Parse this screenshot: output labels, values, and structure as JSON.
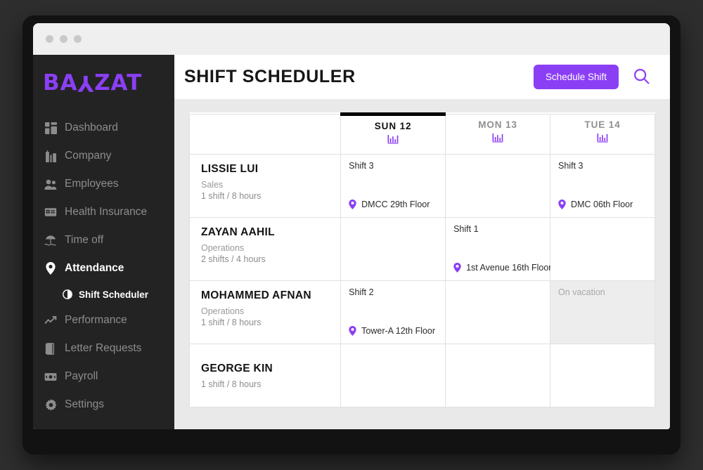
{
  "window": {
    "dots": [
      "close-dot",
      "minimize-dot",
      "maximize-dot"
    ]
  },
  "brand": {
    "logo_full": "BAYZAT",
    "logo_part1": "BA",
    "logo_flip": "Y",
    "logo_part2": "ZAT",
    "color": "#8b3ff5"
  },
  "sidebar": {
    "items": [
      {
        "label": "Dashboard",
        "icon": "dashboard-icon",
        "active": false
      },
      {
        "label": "Company",
        "icon": "company-icon",
        "active": false
      },
      {
        "label": "Employees",
        "icon": "employees-icon",
        "active": false
      },
      {
        "label": "Health Insurance",
        "icon": "health-insurance-icon",
        "active": false
      },
      {
        "label": "Time off",
        "icon": "time-off-icon",
        "active": false
      },
      {
        "label": "Attendance",
        "icon": "location-pin-icon",
        "active": true
      },
      {
        "label": "Performance",
        "icon": "performance-icon",
        "active": false
      },
      {
        "label": "Letter Requests",
        "icon": "letter-requests-icon",
        "active": false
      },
      {
        "label": "Payroll",
        "icon": "payroll-icon",
        "active": false
      },
      {
        "label": "Settings",
        "icon": "settings-gear-icon",
        "active": false
      }
    ],
    "subitem": {
      "label": "Shift Scheduler",
      "icon": "half-circle-icon",
      "active": true
    }
  },
  "header": {
    "title": "SHIFT SCHEDULER",
    "schedule_button": "Schedule Shift",
    "search_icon": "search-icon"
  },
  "table": {
    "columns": [
      {
        "label": "",
        "today": false
      },
      {
        "label": "SUN 12",
        "today": true,
        "icon": "bar-chart-icon"
      },
      {
        "label": "MON 13",
        "today": false,
        "icon": "bar-chart-icon"
      },
      {
        "label": "TUE 14",
        "today": false,
        "icon": "bar-chart-icon"
      }
    ],
    "rows": [
      {
        "name": "LISSIE LUI",
        "dept": "Sales",
        "hours": "1 shift / 8 hours",
        "cells": [
          {
            "shift": "Shift 3",
            "location": "DMCC 29th Floor",
            "state": "shift"
          },
          {
            "shift": "",
            "location": "",
            "state": "empty"
          },
          {
            "shift": "Shift 3",
            "location": "DMC 06th Floor",
            "state": "shift"
          }
        ]
      },
      {
        "name": "ZAYAN AAHIL",
        "dept": "Operations",
        "hours": "2 shifts / 4 hours",
        "cells": [
          {
            "shift": "",
            "location": "",
            "state": "empty"
          },
          {
            "shift": "Shift 1",
            "location": "1st Avenue 16th Floor",
            "state": "shift"
          },
          {
            "shift": "",
            "location": "",
            "state": "empty"
          }
        ]
      },
      {
        "name": "MOHAMMED AFNAN",
        "dept": "Operations",
        "hours": "1 shift / 8 hours",
        "cells": [
          {
            "shift": "Shift 2",
            "location": "Tower-A 12th Floor",
            "state": "shift"
          },
          {
            "shift": "",
            "location": "",
            "state": "empty"
          },
          {
            "shift": "",
            "location": "",
            "state": "vacation",
            "vacation_text": "On vacation"
          }
        ]
      },
      {
        "name": "GEORGE KIN",
        "dept": "",
        "hours": "1 shift / 8 hours",
        "cells": [
          {
            "shift": "",
            "location": "",
            "state": "empty"
          },
          {
            "shift": "",
            "location": "",
            "state": "empty"
          },
          {
            "shift": "",
            "location": "",
            "state": "empty"
          }
        ]
      }
    ]
  }
}
